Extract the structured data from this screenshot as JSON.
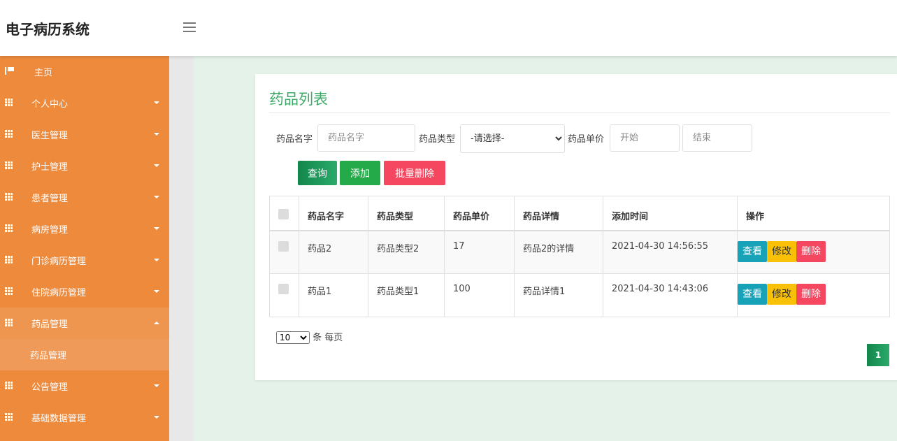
{
  "app": {
    "title": "电子病历系统"
  },
  "sidebar": {
    "items": [
      {
        "label": "主页",
        "icon": "flag-icon"
      },
      {
        "label": "个人中心",
        "icon": "grid-icon"
      },
      {
        "label": "医生管理",
        "icon": "grid-icon"
      },
      {
        "label": "护士管理",
        "icon": "grid-icon"
      },
      {
        "label": "患者管理",
        "icon": "grid-icon"
      },
      {
        "label": "病房管理",
        "icon": "grid-icon"
      },
      {
        "label": "门诊病历管理",
        "icon": "grid-icon"
      },
      {
        "label": "住院病历管理",
        "icon": "grid-icon"
      },
      {
        "label": "药品管理",
        "icon": "grid-icon",
        "expanded": true,
        "children": [
          {
            "label": "药品管理"
          }
        ]
      },
      {
        "label": "公告管理",
        "icon": "grid-icon"
      },
      {
        "label": "基础数据管理",
        "icon": "grid-icon"
      }
    ],
    "color": "#ed8a3c"
  },
  "main": {
    "title": "药品列表",
    "filters": {
      "name_label": "药品名字",
      "name_placeholder": "药品名字",
      "type_label": "药品类型",
      "type_selected": "-请选择-",
      "price_label": "药品单价",
      "price_start_placeholder": "开始",
      "price_end_placeholder": "结束"
    },
    "buttons": {
      "query": "查询",
      "add": "添加",
      "batch_delete": "批量删除"
    },
    "table": {
      "headers": [
        "药品名字",
        "药品类型",
        "药品单价",
        "药品详情",
        "添加时间",
        "操作"
      ],
      "rows": [
        {
          "name": "药品2",
          "type": "药品类型2",
          "price": "17",
          "detail": "药品2的详情",
          "time": "2021-04-30 14:56:55"
        },
        {
          "name": "药品1",
          "type": "药品类型1",
          "price": "100",
          "detail": "药品详情1",
          "time": "2021-04-30 14:43:06"
        }
      ],
      "actions": {
        "view": "查看",
        "edit": "修改",
        "delete": "删除"
      }
    },
    "pagination": {
      "page_size": "10",
      "page_size_suffix": "条 每页",
      "current_page": "1"
    }
  }
}
